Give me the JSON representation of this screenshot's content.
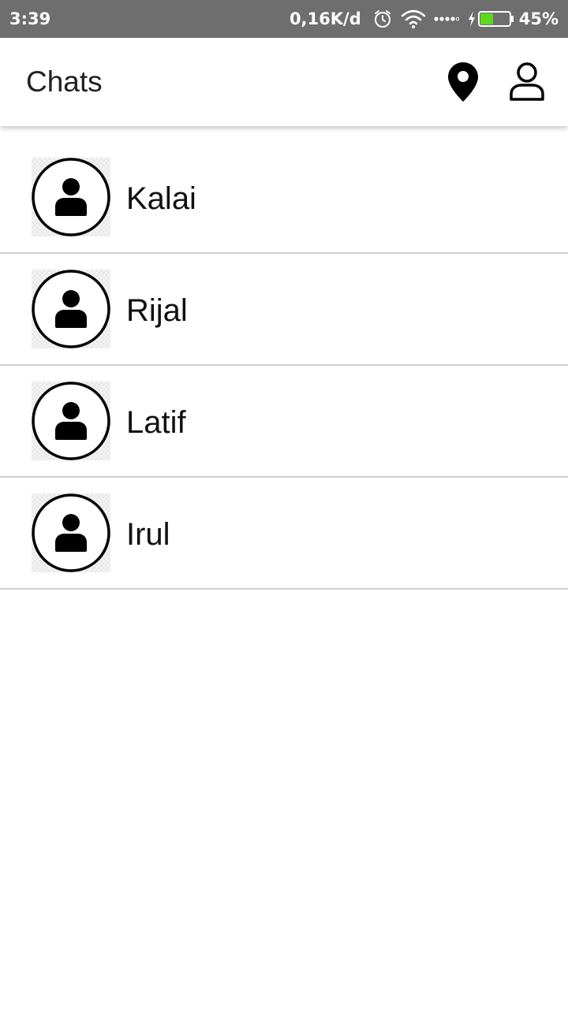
{
  "status_bar": {
    "time": "3:39",
    "network_speed": "0,16K/d",
    "battery_percent": "45%",
    "battery_level": 0.45,
    "icons": [
      "alarm-icon",
      "wifi-icon",
      "signal-icon",
      "charging-icon",
      "battery-icon"
    ],
    "battery_color": "#5bd91e"
  },
  "app_bar": {
    "title": "Chats",
    "actions": [
      "location-pin-icon",
      "profile-icon"
    ]
  },
  "chats": [
    {
      "name": "Kalai"
    },
    {
      "name": "Rijal"
    },
    {
      "name": "Latif"
    },
    {
      "name": "Irul"
    }
  ]
}
